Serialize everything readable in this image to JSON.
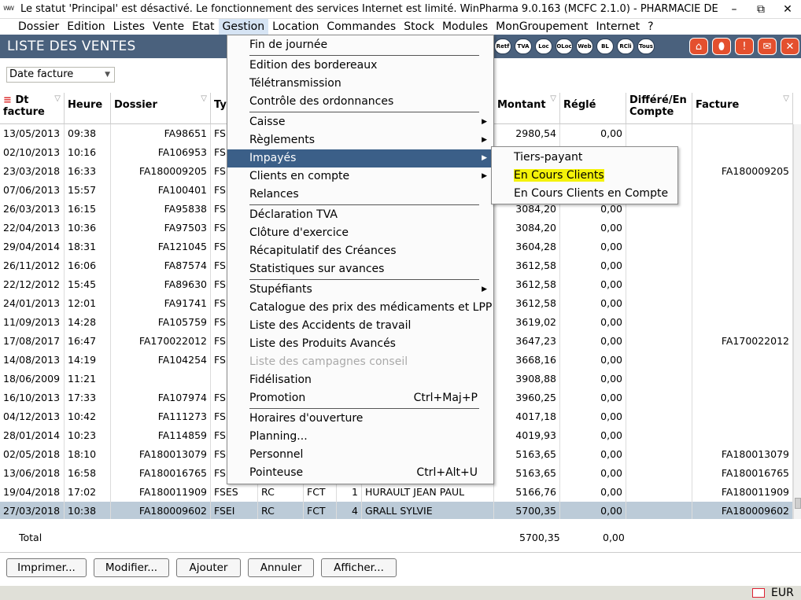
{
  "window": {
    "title": "Le statut 'Principal' est désactivé. Le fonctionnement des services Internet est limité. WinPharma 9.0.163  (MCFC 2.1.0) - PHARMACIE DE LA LIBERATI...",
    "minimize": "–",
    "restore": "⧉",
    "close": "✕"
  },
  "menubar": [
    "Dossier",
    "Edition",
    "Listes",
    "Vente",
    "Etat",
    "Gestion",
    "Location",
    "Commandes",
    "Stock",
    "Modules",
    "MonGroupement",
    "Internet",
    "?"
  ],
  "active_menu": "Gestion",
  "header": {
    "title": "LISTE DES VENTES",
    "round_buttons": [
      "Retf",
      "TVA",
      "Loc",
      "OLoc",
      "Web",
      "BL",
      "RCli",
      "Tous"
    ],
    "square_icons": [
      "home-icon",
      "pill-icon",
      "alert-icon",
      "mail-icon",
      "close-icon"
    ]
  },
  "sort": {
    "value": "Date facture",
    "arrow": "▼"
  },
  "columns": {
    "dt": "Dt facture",
    "heure": "Heure",
    "dossier": "Dossier",
    "type": "Typ",
    "montant": "Montant",
    "regle": "Réglé",
    "differe": "Différé/En Compte",
    "facture": "Facture"
  },
  "filter_glyph": "▽",
  "sort_glyph": "≡",
  "rows": [
    {
      "dt": "13/05/2013",
      "heure": "09:38",
      "dossier": "FA98651",
      "type": "FSE",
      "montant": "2980,54",
      "regle": "0,00",
      "facture": ""
    },
    {
      "dt": "02/10/2013",
      "heure": "10:16",
      "dossier": "FA106953",
      "type": "FSE",
      "montant": "",
      "regle": "",
      "facture": ""
    },
    {
      "dt": "23/03/2018",
      "heure": "16:33",
      "dossier": "FA180009205",
      "type": "FSE",
      "montant": "",
      "regle": "",
      "facture": "FA180009205"
    },
    {
      "dt": "07/06/2013",
      "heure": "15:57",
      "dossier": "FA100401",
      "type": "FSE",
      "montant": "",
      "regle": "",
      "facture": ""
    },
    {
      "dt": "26/03/2013",
      "heure": "16:15",
      "dossier": "FA95838",
      "type": "FSE",
      "montant": "3084,20",
      "regle": "0,00",
      "facture": ""
    },
    {
      "dt": "22/04/2013",
      "heure": "10:36",
      "dossier": "FA97503",
      "type": "FSE",
      "montant": "3084,20",
      "regle": "0,00",
      "facture": ""
    },
    {
      "dt": "29/04/2014",
      "heure": "18:31",
      "dossier": "FA121045",
      "type": "FSE",
      "montant": "3604,28",
      "regle": "0,00",
      "facture": ""
    },
    {
      "dt": "26/11/2012",
      "heure": "16:06",
      "dossier": "FA87574",
      "type": "FSE",
      "montant": "3612,58",
      "regle": "0,00",
      "facture": ""
    },
    {
      "dt": "22/12/2012",
      "heure": "15:45",
      "dossier": "FA89630",
      "type": "FSE",
      "montant": "3612,58",
      "regle": "0,00",
      "facture": ""
    },
    {
      "dt": "24/01/2013",
      "heure": "12:01",
      "dossier": "FA91741",
      "type": "FSE",
      "montant": "3612,58",
      "regle": "0,00",
      "facture": ""
    },
    {
      "dt": "11/09/2013",
      "heure": "14:28",
      "dossier": "FA105759",
      "type": "FSE",
      "montant": "3619,02",
      "regle": "0,00",
      "facture": ""
    },
    {
      "dt": "17/08/2017",
      "heure": "16:47",
      "dossier": "FA170022012",
      "type": "FSE",
      "montant": "3647,23",
      "regle": "0,00",
      "facture": "FA170022012"
    },
    {
      "dt": "14/08/2013",
      "heure": "14:19",
      "dossier": "FA104254",
      "type": "FSE",
      "montant": "3668,16",
      "regle": "0,00",
      "facture": ""
    },
    {
      "dt": "18/06/2009",
      "heure": "11:21",
      "dossier": "",
      "type": "",
      "montant": "3908,88",
      "regle": "0,00",
      "facture": ""
    },
    {
      "dt": "16/10/2013",
      "heure": "17:33",
      "dossier": "FA107974",
      "type": "FSE",
      "montant": "3960,25",
      "regle": "0,00",
      "facture": ""
    },
    {
      "dt": "04/12/2013",
      "heure": "10:42",
      "dossier": "FA111273",
      "type": "FSE",
      "montant": "4017,18",
      "regle": "0,00",
      "facture": ""
    },
    {
      "dt": "28/01/2014",
      "heure": "10:23",
      "dossier": "FA114859",
      "type": "FSE",
      "montant": "4019,93",
      "regle": "0,00",
      "facture": ""
    },
    {
      "dt": "02/05/2018",
      "heure": "18:10",
      "dossier": "FA180013079",
      "type": "FSE",
      "montant": "5163,65",
      "regle": "0,00",
      "facture": "FA180013079"
    },
    {
      "dt": "13/06/2018",
      "heure": "16:58",
      "dossier": "FA180016765",
      "type": "FSE",
      "montant": "5163,65",
      "regle": "0,00",
      "facture": "FA180016765"
    },
    {
      "dt": "19/04/2018",
      "heure": "17:02",
      "dossier": "FA180011909",
      "type": "FSES",
      "col5": "RC",
      "col6": "FCT",
      "col7": "1",
      "client": "HURAULT JEAN PAUL",
      "montant": "5166,76",
      "regle": "0,00",
      "facture": "FA180011909"
    },
    {
      "dt": "27/03/2018",
      "heure": "10:38",
      "dossier": "FA180009602",
      "type": "FSEI",
      "col5": "RC",
      "col6": "FCT",
      "col7": "4",
      "client": "GRALL SYLVIE",
      "montant": "5700,35",
      "regle": "0,00",
      "facture": "FA180009602",
      "selected": true
    }
  ],
  "total": {
    "label": "Total",
    "montant": "5700,35",
    "regle": "0,00"
  },
  "buttons": [
    "Imprimer...",
    "Modifier...",
    "Ajouter",
    "Annuler",
    "Afficher..."
  ],
  "status": {
    "currency": "EUR"
  },
  "gestion_menu": [
    {
      "label": "Fin de journée"
    },
    {
      "sep": true
    },
    {
      "label": "Edition des bordereaux"
    },
    {
      "label": "Télétransmission"
    },
    {
      "label": "Contrôle des ordonnances"
    },
    {
      "sep": true
    },
    {
      "label": "Caisse",
      "sub": true
    },
    {
      "label": "Règlements",
      "sub": true
    },
    {
      "label": "Impayés",
      "sub": true,
      "highlight": true
    },
    {
      "label": "Clients en compte",
      "sub": true
    },
    {
      "label": "Relances"
    },
    {
      "sep": true
    },
    {
      "label": "Déclaration TVA"
    },
    {
      "label": "Clôture d'exercice"
    },
    {
      "label": "Récapitulatif des Créances"
    },
    {
      "label": "Statistiques sur avances"
    },
    {
      "sep": true
    },
    {
      "label": "Stupéfiants",
      "sub": true
    },
    {
      "label": "Catalogue des prix des médicaments et LPP"
    },
    {
      "label": "Liste des Accidents de travail"
    },
    {
      "label": "Liste des Produits Avancés"
    },
    {
      "label": "Liste des campagnes conseil",
      "disabled": true
    },
    {
      "label": "Fidélisation"
    },
    {
      "label": "Promotion",
      "shortcut": "Ctrl+Maj+P"
    },
    {
      "sep": true
    },
    {
      "label": "Horaires d'ouverture"
    },
    {
      "label": "Planning..."
    },
    {
      "label": "Personnel"
    },
    {
      "label": "Pointeuse",
      "shortcut": "Ctrl+Alt+U"
    }
  ],
  "impayes_submenu": [
    {
      "label": "Tiers-payant"
    },
    {
      "label": "En Cours Clients",
      "marked": true
    },
    {
      "label": "En Cours Clients en Compte"
    }
  ],
  "submenu_arrow": "▶",
  "colors": {
    "band": "#4a617d",
    "highlight": "#3b5f88",
    "selected_row": "#bccbd8",
    "marker": "#f4f20a",
    "icon_orange": "#e4502e"
  }
}
